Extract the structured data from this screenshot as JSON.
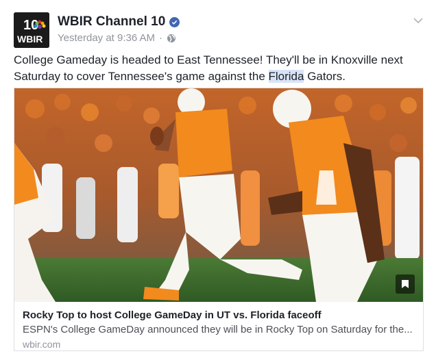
{
  "post": {
    "page_name": "WBIR Channel 10",
    "timestamp": "Yesterday at 9:36 AM",
    "separator": "·",
    "text_before": "College Gameday is headed to East Tennessee! They'll be in Knoxville next Saturday to cover Tennessee's game against the ",
    "text_highlight": "Florida",
    "text_after": " Gators."
  },
  "avatar": {
    "top_text": "10",
    "brand_text": "WBIR"
  },
  "link_card": {
    "title": "Rocky Top to host College GameDay in UT vs. Florida faceoff",
    "description": "ESPN's College GameDay announced they will be in Rocky Top on Saturday for the...",
    "domain": "wbir.com"
  },
  "colors": {
    "verified": "#4267b2",
    "jersey_orange": "#f28a1e",
    "field_green": "#3f6b2e",
    "highlight": "#d8e4f6"
  },
  "icons": {
    "verified": "verified-badge-icon",
    "privacy": "globe-icon",
    "options": "chevron-down-icon",
    "save": "bookmark-icon"
  }
}
